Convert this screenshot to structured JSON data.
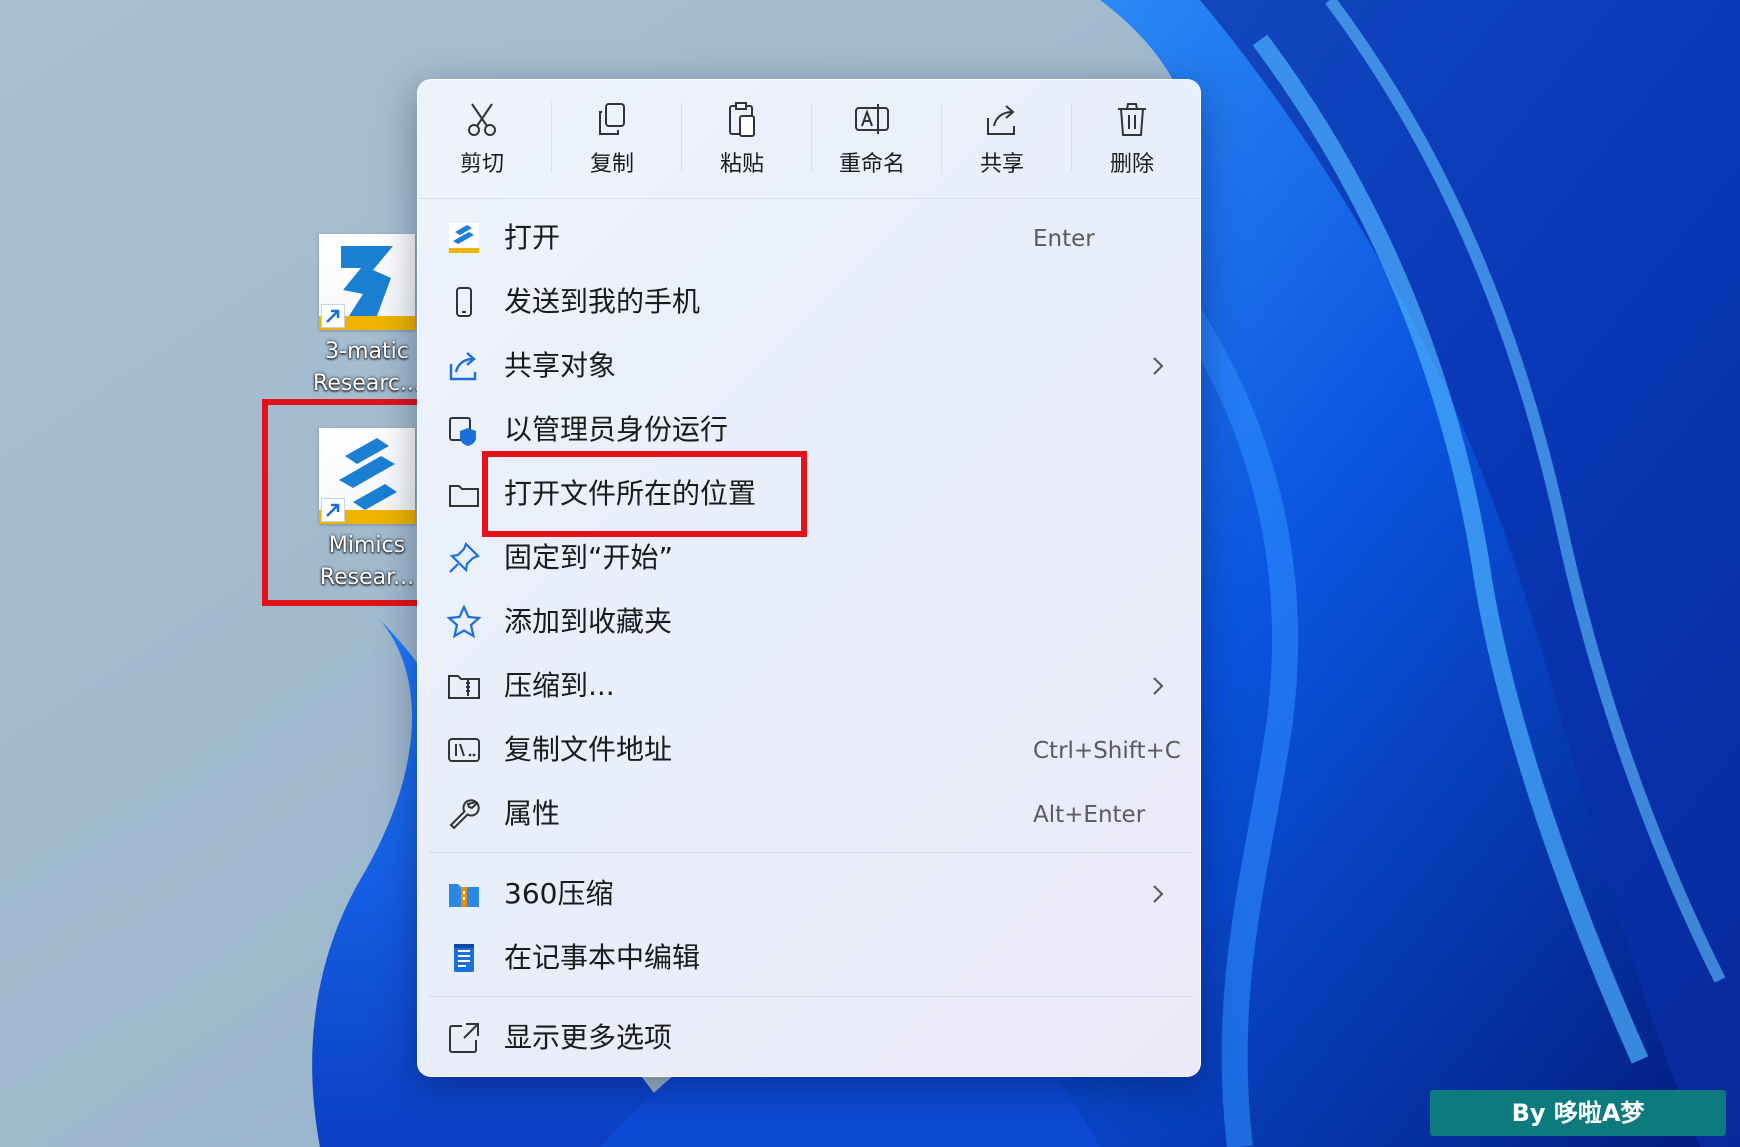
{
  "toolbar": {
    "cut": "剪切",
    "copy": "复制",
    "paste": "粘贴",
    "rename": "重命名",
    "share": "共享",
    "delete": "删除"
  },
  "menu": {
    "items": [
      {
        "label": "打开",
        "shortcut": "Enter",
        "icon": "mimics-app-icon"
      },
      {
        "label": "发送到我的手机",
        "icon": "phone-icon"
      },
      {
        "label": "共享对象",
        "icon": "share-icon",
        "submenu": true
      },
      {
        "label": "以管理员身份运行",
        "icon": "admin-shield-icon"
      },
      {
        "label": "打开文件所在的位置",
        "icon": "folder-icon",
        "highlighted": true
      },
      {
        "label": "固定到“开始”",
        "icon": "pin-icon"
      },
      {
        "label": "添加到收藏夹",
        "icon": "star-icon"
      },
      {
        "label": "压缩到...",
        "icon": "zip-icon",
        "submenu": true
      },
      {
        "label": "复制文件地址",
        "shortcut": "Ctrl+Shift+C",
        "icon": "copy-path-icon"
      },
      {
        "label": "属性",
        "shortcut": "Alt+Enter",
        "icon": "wrench-icon"
      }
    ],
    "extra_items": [
      {
        "label": "360压缩",
        "icon": "360zip-icon",
        "submenu": true
      },
      {
        "label": "在记事本中编辑",
        "icon": "notepad-icon"
      }
    ],
    "more": {
      "label": "显示更多选项",
      "icon": "more-options-icon"
    }
  },
  "desktop": {
    "icons": [
      {
        "label": "3-matic\nResearc..."
      },
      {
        "label": "Mimics\nResear..."
      }
    ]
  },
  "watermark": "By 哆啦A梦",
  "colors": {
    "highlight_box": "#e3121a",
    "accent": "#1a6fd9",
    "watermark_bg": "#0d7a7e"
  }
}
